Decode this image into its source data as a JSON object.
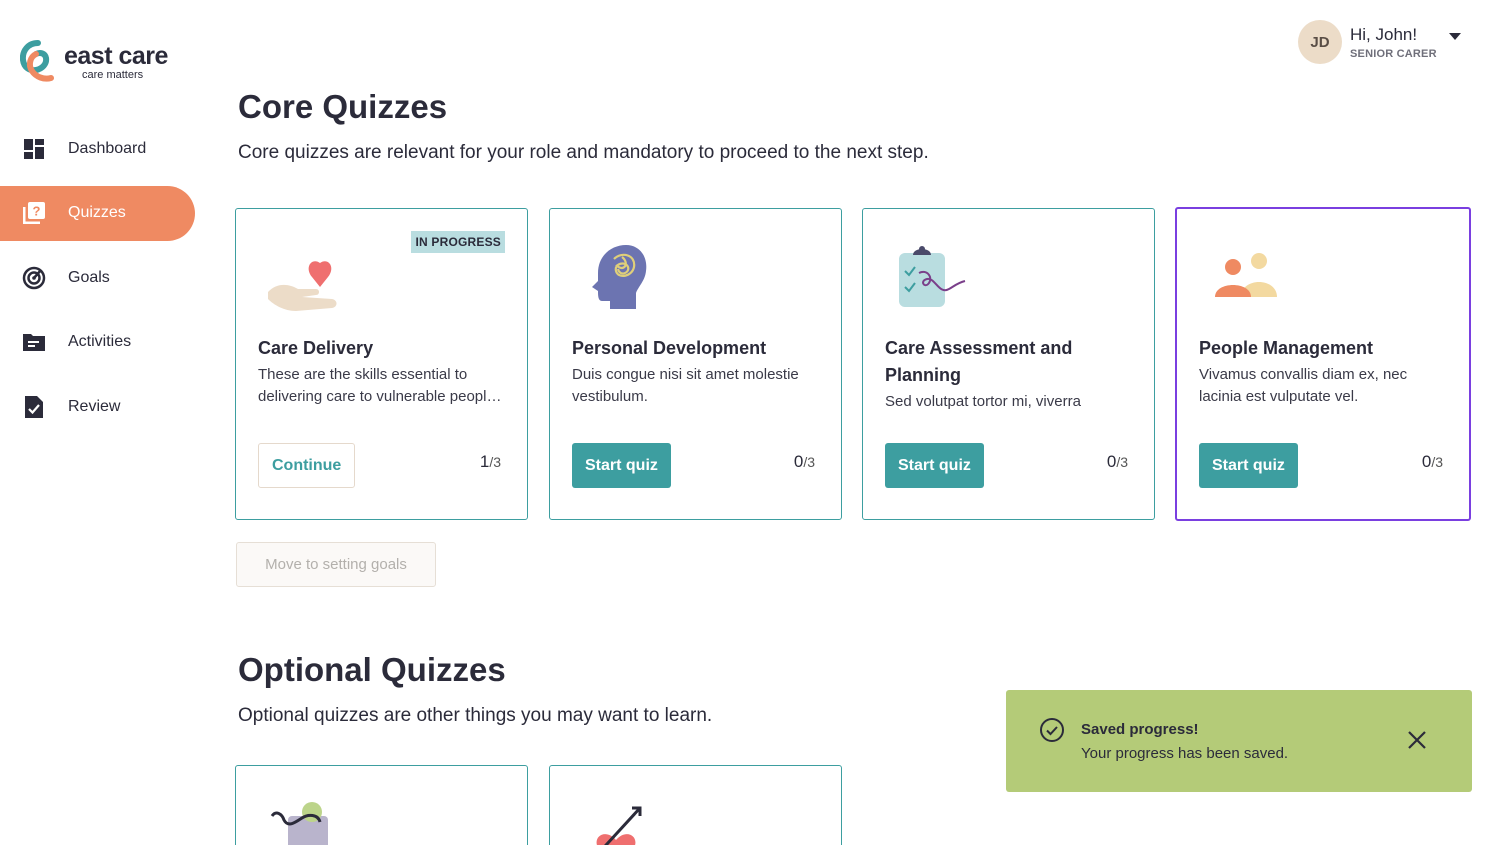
{
  "brand": {
    "name": "east care",
    "tagline": "care matters",
    "colors": {
      "teal": "#3d9ea0",
      "orange": "#ef8a62",
      "ink": "#2b2b3a"
    }
  },
  "user": {
    "initials": "JD",
    "greeting": "Hi, John!",
    "role": "SENIOR CARER"
  },
  "sidebar": {
    "items": [
      {
        "label": "Dashboard",
        "icon": "dashboard-icon",
        "active": false
      },
      {
        "label": "Quizzes",
        "icon": "quiz-icon",
        "active": true
      },
      {
        "label": "Goals",
        "icon": "goals-icon",
        "active": false
      },
      {
        "label": "Activities",
        "icon": "folder-icon",
        "active": false
      },
      {
        "label": "Review",
        "icon": "review-doc-icon",
        "active": false
      }
    ]
  },
  "core": {
    "title": "Core Quizzes",
    "subtitle": "Core quizzes are relevant for your role and mandatory to proceed to the next step.",
    "cards": [
      {
        "title": "Care Delivery",
        "description": "These are the skills essential to delivering care to vulnerable people in our community.",
        "badge": "IN PROGRESS",
        "button": "Continue",
        "done": "1",
        "total": "/3",
        "illustration": "hand-heart-illustration"
      },
      {
        "title": "Personal Development",
        "description": "Duis congue nisi sit amet molestie vestibulum.",
        "badge": "",
        "button": "Start quiz",
        "done": "0",
        "total": "/3",
        "illustration": "head-thoughts-illustration"
      },
      {
        "title": "Care Assessment and Planning",
        "description": "Sed volutpat tortor mi, viverra",
        "badge": "",
        "button": "Start quiz",
        "done": "0",
        "total": "/3",
        "illustration": "clipboard-illustration"
      },
      {
        "title": "People Management",
        "description": "Vivamus convallis diam ex, nec lacinia est vulputate vel.",
        "badge": "",
        "button": "Start quiz",
        "done": "0",
        "total": "/3",
        "illustration": "people-illustration"
      }
    ],
    "next_button": "Move to setting goals"
  },
  "optional": {
    "title": "Optional Quizzes",
    "subtitle": "Optional quizzes are other things you may want to learn."
  },
  "toast": {
    "title": "Saved progress!",
    "message": "Your progress has been saved."
  }
}
